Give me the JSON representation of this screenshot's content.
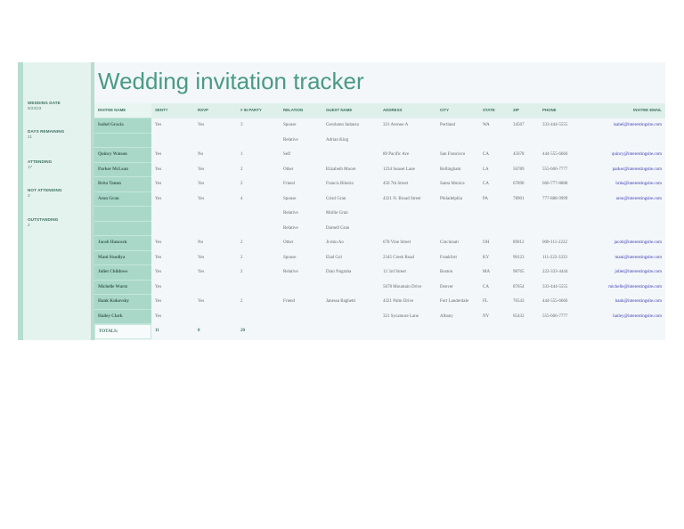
{
  "title": "Wedding invitation tracker",
  "sidebar": [
    {
      "label": "WEDDING DATE",
      "value": "9/23/23"
    },
    {
      "label": "DAYS REMAINING",
      "value": "21"
    },
    {
      "label": "ATTENDING",
      "value": "17"
    },
    {
      "label": "NOT ATTENDING",
      "value": "3"
    },
    {
      "label": "OUTSTANDING",
      "value": "2"
    }
  ],
  "columns": [
    "INVITEE NAME",
    "SENT?",
    "RSVP",
    "# IN PARTY",
    "RELATION",
    "GUEST NAME",
    "ADDRESS",
    "CITY",
    "STATE",
    "ZIP",
    "PHONE",
    "INVITEE EMAIL"
  ],
  "rows": [
    [
      "Isabel Gracia",
      "Yes",
      "Yes",
      "3",
      "Spouse",
      "Gerolamo Iadanza",
      "321 Avenue A",
      "Portland",
      "WA",
      "34567",
      "333-444-5555",
      "isabel@interestingsite.com"
    ],
    [
      "",
      "",
      "",
      "",
      "Relative",
      "Adrian King",
      "",
      "",
      "",
      "",
      "",
      ""
    ],
    [
      "Quincy Watson",
      "Yes",
      "No",
      "1",
      "Self",
      "",
      "89 Pacific Ave",
      "San Francisco",
      "CA",
      "45678",
      "444-555-6666",
      "quincy@interestingsite.com"
    ],
    [
      "Parker McLean",
      "Yes",
      "Yes",
      "2",
      "Other",
      "Elizabeth Moore",
      "1234 Sunset Lane",
      "Bellingham",
      "LA",
      "56789",
      "555-666-7777",
      "parker@interestingsite.com"
    ],
    [
      "Brita Tamm",
      "Yes",
      "Yes",
      "2",
      "Friend",
      "Francis Ribeiro",
      "456 7th Street",
      "Santa Monica",
      "CA",
      "67890",
      "666-777-8888",
      "brita@interestingsite.com"
    ],
    [
      "Aron Gran",
      "Yes",
      "Yes",
      "4",
      "Spouse",
      "Cristi Gran",
      "4321 N. Broad Street",
      "Philadelphia",
      "PA",
      "78901",
      "777-888-9999",
      "aron@interestingsite.com"
    ],
    [
      "",
      "",
      "",
      "",
      "Relative",
      "Mollie Gran",
      "",
      "",
      "",
      "",
      "",
      ""
    ],
    [
      "",
      "",
      "",
      "",
      "Relative",
      "Darnell Gran",
      "",
      "",
      "",
      "",
      "",
      ""
    ],
    [
      "Jacob Hancock",
      "Yes",
      "No",
      "2",
      "Other",
      "Ji-min Ao",
      "678 Vine Street",
      "Cincinnati",
      "OH",
      "89012",
      "000-111-2222",
      "jacob@interestingsite.com"
    ],
    [
      "Mani Sisodiya",
      "Yes",
      "Yes",
      "2",
      "Spouse",
      "Elad Gol",
      "2345 Creek Road",
      "Frankfort",
      "KY",
      "90123",
      "111-222-3333",
      "mani@interestingsite.com"
    ],
    [
      "Juliet Childress",
      "Yes",
      "Yes",
      "2",
      "Relative",
      "Dian Nugraha",
      "12 3rd Street",
      "Boston",
      "MA",
      "98765",
      "222-333-4444",
      "juliet@interestingsite.com"
    ],
    [
      "Michelle Wurtz",
      "Yes",
      "",
      "",
      "",
      "",
      "5678 Mountain Drive",
      "Denver",
      "CA",
      "87654",
      "333-444-5555",
      "michelle@interestingsite.com"
    ],
    [
      "Hank Kukovsky",
      "Yes",
      "Yes",
      "2",
      "Friend",
      "Janessa Baghetti",
      "4321 Palm Drive",
      "Fort Lauderdale",
      "FL",
      "76543",
      "444-555-6666",
      "hank@interestingsite.com"
    ],
    [
      "Hailey Clark",
      "Yes",
      "",
      "",
      "",
      "",
      "321 Sycamore Lane",
      "Albany",
      "NY",
      "65432",
      "555-666-7777",
      "hailey@interestingsite.com"
    ]
  ],
  "totals": {
    "label": "TOTALS:",
    "sent": "11",
    "rsvp": "8",
    "party": "20"
  },
  "colors": {
    "accent": "#4a9a85",
    "name_col": "#a9d8c9",
    "header": "#dff0ea",
    "email": "#3b3bb0"
  }
}
